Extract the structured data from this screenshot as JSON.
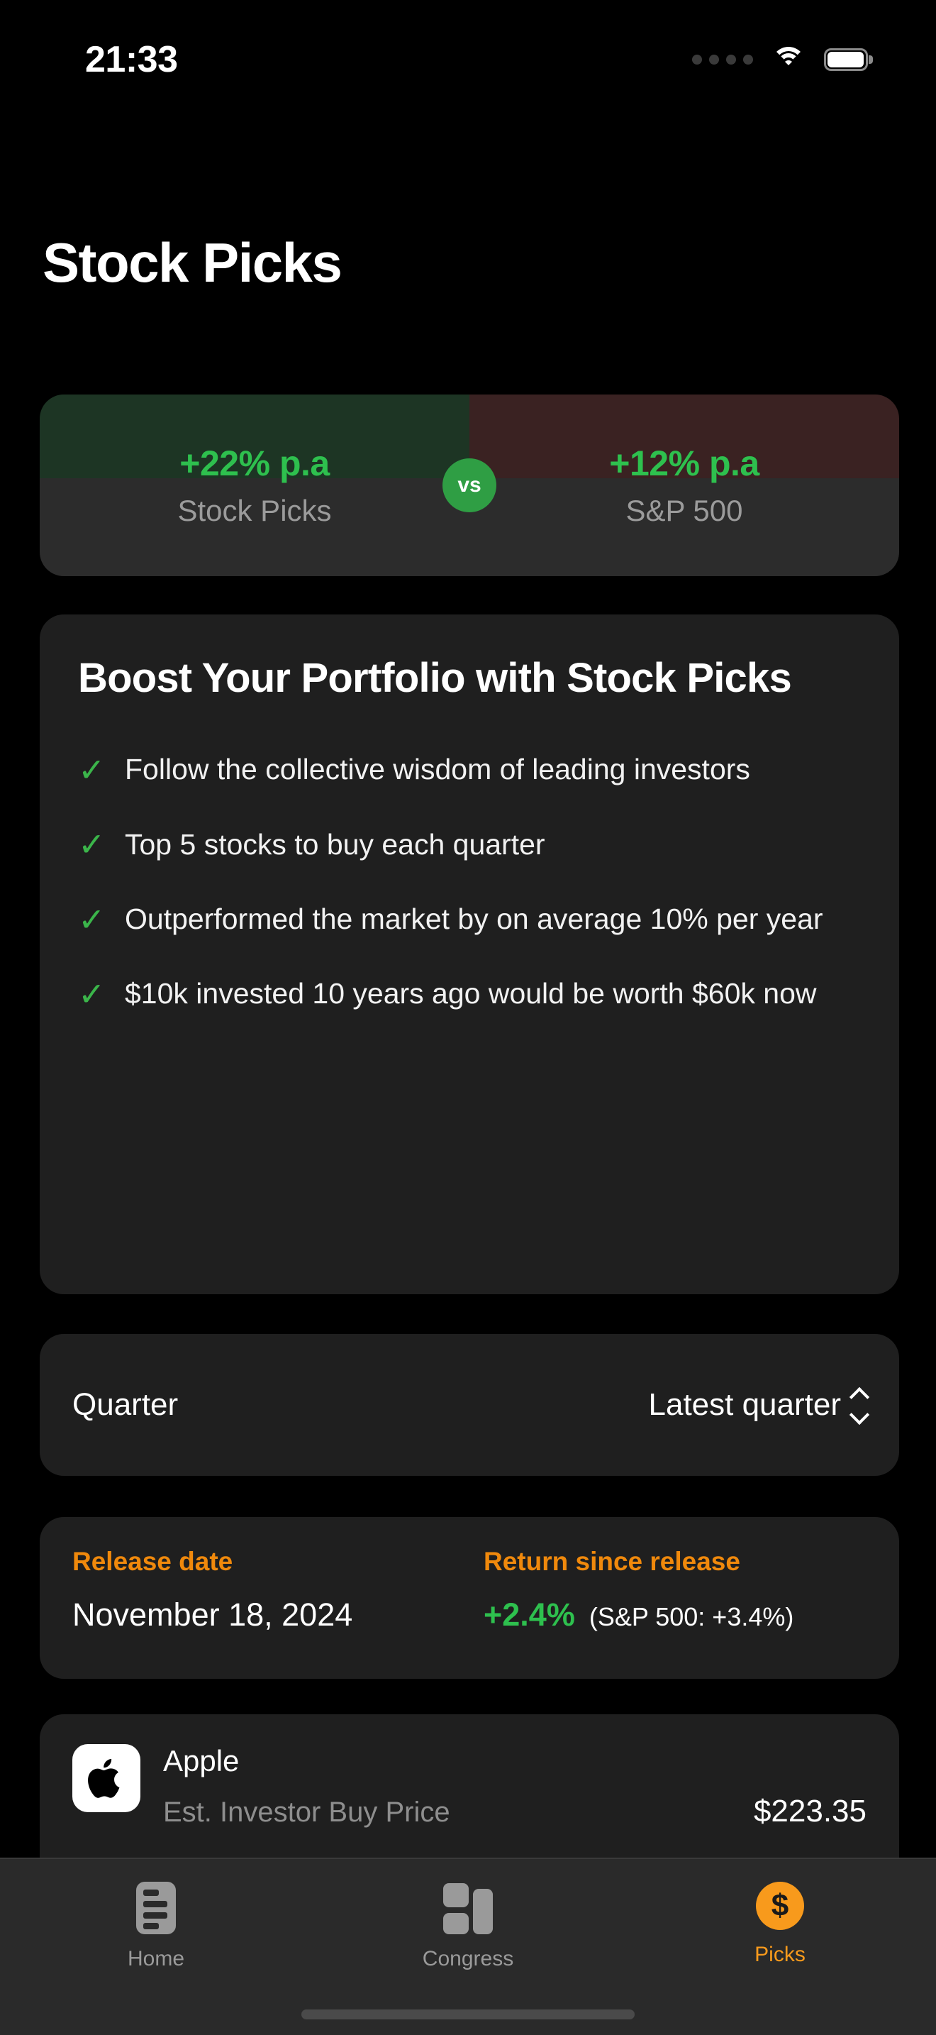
{
  "status_bar": {
    "time": "21:33",
    "cellular_icon": "cellular-dots-icon",
    "wifi_icon": "wifi-icon",
    "battery_icon": "battery-full-icon"
  },
  "header": {
    "title": "Stock Picks"
  },
  "comparison": {
    "vs_label": "vs",
    "left": {
      "percent": "+22% p.a",
      "name": "Stock Picks"
    },
    "right": {
      "percent": "+12% p.a",
      "name": "S&P 500"
    },
    "colors": {
      "left_tint": "#1d3524",
      "right_tint": "#3a2222",
      "base": "#2c2c2c",
      "percent_green": "#2ec04e",
      "vs_badge": "#2f9e44"
    }
  },
  "boost_card": {
    "title": "Boost Your Portfolio with Stock Picks",
    "check_icon": "check-icon",
    "bullets": [
      "Follow the collective wisdom of leading investors",
      "Top 5 stocks to buy each quarter",
      "Outperformed the market by on average 10% per year",
      "$10k invested 10 years ago would be worth $60k now"
    ]
  },
  "quarter_selector": {
    "label": "Quarter",
    "value": "Latest quarter",
    "chevron_icon": "chevron-up-down-icon"
  },
  "release_card": {
    "release_date_label": "Release date",
    "release_date_value": "November 18, 2024",
    "return_label": "Return since release",
    "return_value": "+2.4%",
    "benchmark_value": "(S&P 500: +3.4%)",
    "label_color": "#f0890c",
    "return_color": "#2ec04e"
  },
  "stock_list": [
    {
      "logo_icon": "apple-logo-icon",
      "name": "Apple",
      "sub_label": "Est. Investor Buy Price",
      "price": "$223.35"
    }
  ],
  "tab_bar": {
    "accent_color": "#f89a1c",
    "tabs": [
      {
        "label": "Home",
        "icon": "home-list-icon",
        "active": false
      },
      {
        "label": "Congress",
        "icon": "congress-blocks-icon",
        "active": false
      },
      {
        "label": "Picks",
        "icon": "dollar-circle-icon",
        "active": true
      }
    ]
  }
}
